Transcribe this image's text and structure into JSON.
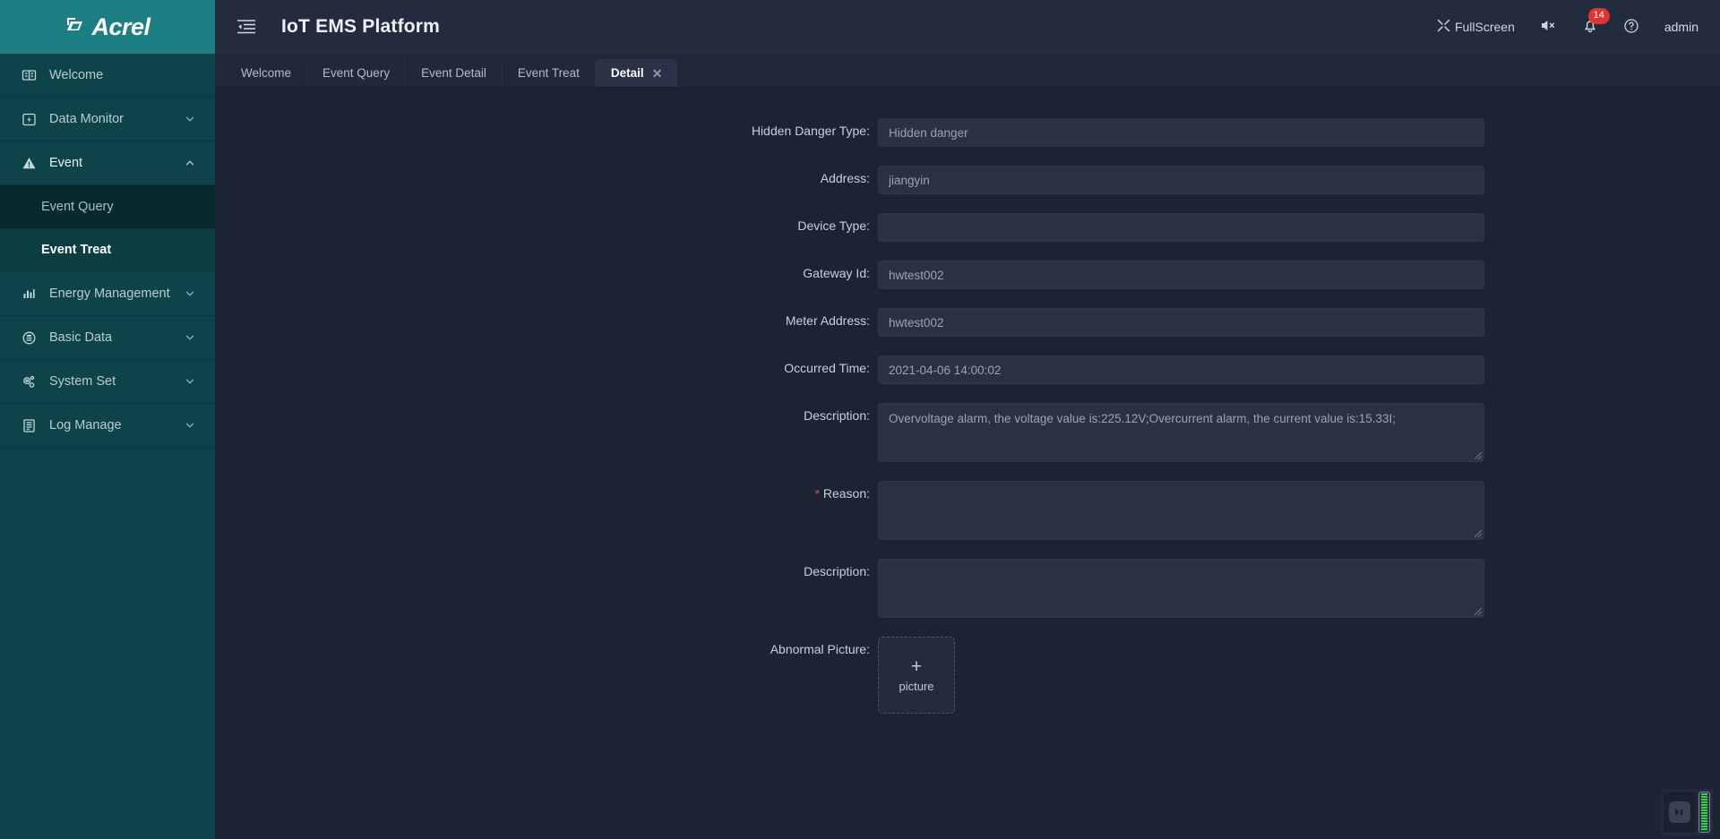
{
  "brand": {
    "name": "Acrel",
    "logo_icon": "acrel-logo-icon"
  },
  "sidebar": {
    "items": [
      {
        "label": "Welcome",
        "icon": "welcome-icon",
        "expandable": false
      },
      {
        "label": "Data Monitor",
        "icon": "data-monitor-icon",
        "expandable": true
      },
      {
        "label": "Event",
        "icon": "event-warning-icon",
        "expandable": true,
        "expanded": true
      },
      {
        "label": "Energy Management",
        "icon": "energy-chart-icon",
        "expandable": true
      },
      {
        "label": "Basic Data",
        "icon": "basic-data-icon",
        "expandable": true
      },
      {
        "label": "System Set",
        "icon": "system-set-gear-icon",
        "expandable": true
      },
      {
        "label": "Log Manage",
        "icon": "log-manage-icon",
        "expandable": true
      }
    ],
    "event_submenu": [
      {
        "label": "Event Query",
        "active": false
      },
      {
        "label": "Event Treat",
        "active": true
      }
    ]
  },
  "header": {
    "menu_toggle_icon": "hamburger-collapse-icon",
    "title": "IoT EMS Platform",
    "fullscreen_label": "FullScreen",
    "fullscreen_icon": "fullscreen-expand-icon",
    "mute_icon": "speaker-muted-icon",
    "bell_icon": "bell-notification-icon",
    "bell_badge": "14",
    "help_icon": "help-question-icon",
    "username": "admin"
  },
  "tabs": [
    {
      "label": "Welcome",
      "active": false,
      "closable": false
    },
    {
      "label": "Event Query",
      "active": false,
      "closable": false
    },
    {
      "label": "Event Detail",
      "active": false,
      "closable": false
    },
    {
      "label": "Event Treat",
      "active": false,
      "closable": false
    },
    {
      "label": "Detail",
      "active": true,
      "closable": true,
      "close_glyph": "✕"
    }
  ],
  "form": {
    "fields": [
      {
        "label": "Hidden Danger Type:",
        "value": "Hidden danger",
        "required": false,
        "type": "input",
        "name": "hidden-danger-type"
      },
      {
        "label": "Address:",
        "value": "jiangyin",
        "required": false,
        "type": "input",
        "name": "address"
      },
      {
        "label": "Device Type:",
        "value": "",
        "required": false,
        "type": "input",
        "name": "device-type"
      },
      {
        "label": "Gateway Id:",
        "value": "hwtest002",
        "required": false,
        "type": "input",
        "name": "gateway-id"
      },
      {
        "label": "Meter Address:",
        "value": "hwtest002",
        "required": false,
        "type": "input",
        "name": "meter-address"
      },
      {
        "label": "Occurred Time:",
        "value": "2021-04-06 14:00:02",
        "required": false,
        "type": "input",
        "name": "occurred-time"
      }
    ],
    "description_readonly": {
      "label": "Description:",
      "value": "Overvoltage alarm, the voltage value is:225.12V;Overcurrent alarm, the current value is:15.33I;",
      "name": "description-readonly"
    },
    "reason": {
      "label": "Reason:",
      "value": "",
      "required": true,
      "required_glyph": "*",
      "name": "reason"
    },
    "description_input": {
      "label": "Description:",
      "value": "",
      "required": false,
      "name": "description-input"
    },
    "abnormal_picture": {
      "label": "Abnormal Picture:",
      "plus_glyph": "+",
      "caption": "picture",
      "name": "abnormal-picture-upload"
    }
  },
  "colors": {
    "sidebar_bg": "#0d4349",
    "logo_bg": "#1d7e84",
    "topbar_bg": "#232b3e",
    "content_bg": "#1c2333",
    "input_bg": "#2a3142",
    "badge_red": "#e03434",
    "required_red": "#e8536b",
    "scrollbar_teal": "#4b7f83",
    "meter_green": "#34d04a"
  }
}
